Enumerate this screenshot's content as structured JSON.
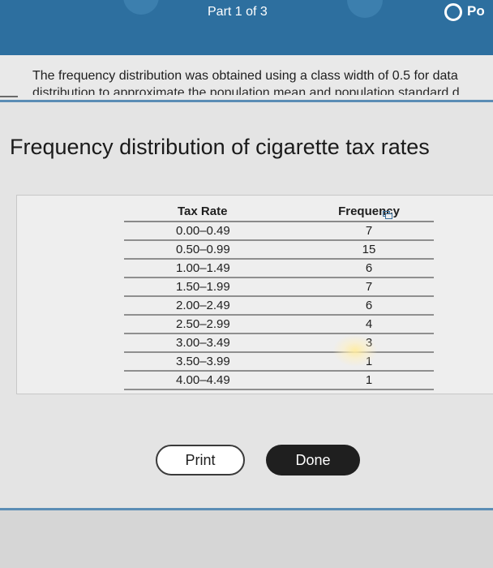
{
  "header": {
    "part_label": "Part 1 of 3",
    "points_label": "Po",
    "color": "#2d6f9f"
  },
  "question": {
    "line1": "The frequency distribution was obtained using a class width of 0.5 for data",
    "line2": "distribution to approximate the population mean and population standard d"
  },
  "dialog": {
    "title": "Frequency distribution of cigarette tax rates",
    "columns": [
      "Tax Rate",
      "Frequency"
    ],
    "rows": [
      {
        "rate": "0.00–0.49",
        "freq": "7"
      },
      {
        "rate": "0.50–0.99",
        "freq": "15"
      },
      {
        "rate": "1.00–1.49",
        "freq": "6"
      },
      {
        "rate": "1.50–1.99",
        "freq": "7"
      },
      {
        "rate": "2.00–2.49",
        "freq": "6"
      },
      {
        "rate": "2.50–2.99",
        "freq": "4"
      },
      {
        "rate": "3.00–3.49",
        "freq": "3"
      },
      {
        "rate": "3.50–3.99",
        "freq": "1"
      },
      {
        "rate": "4.00–4.49",
        "freq": "1"
      }
    ],
    "copy_icon": "copy-icon",
    "print_label": "Print",
    "done_label": "Done"
  }
}
